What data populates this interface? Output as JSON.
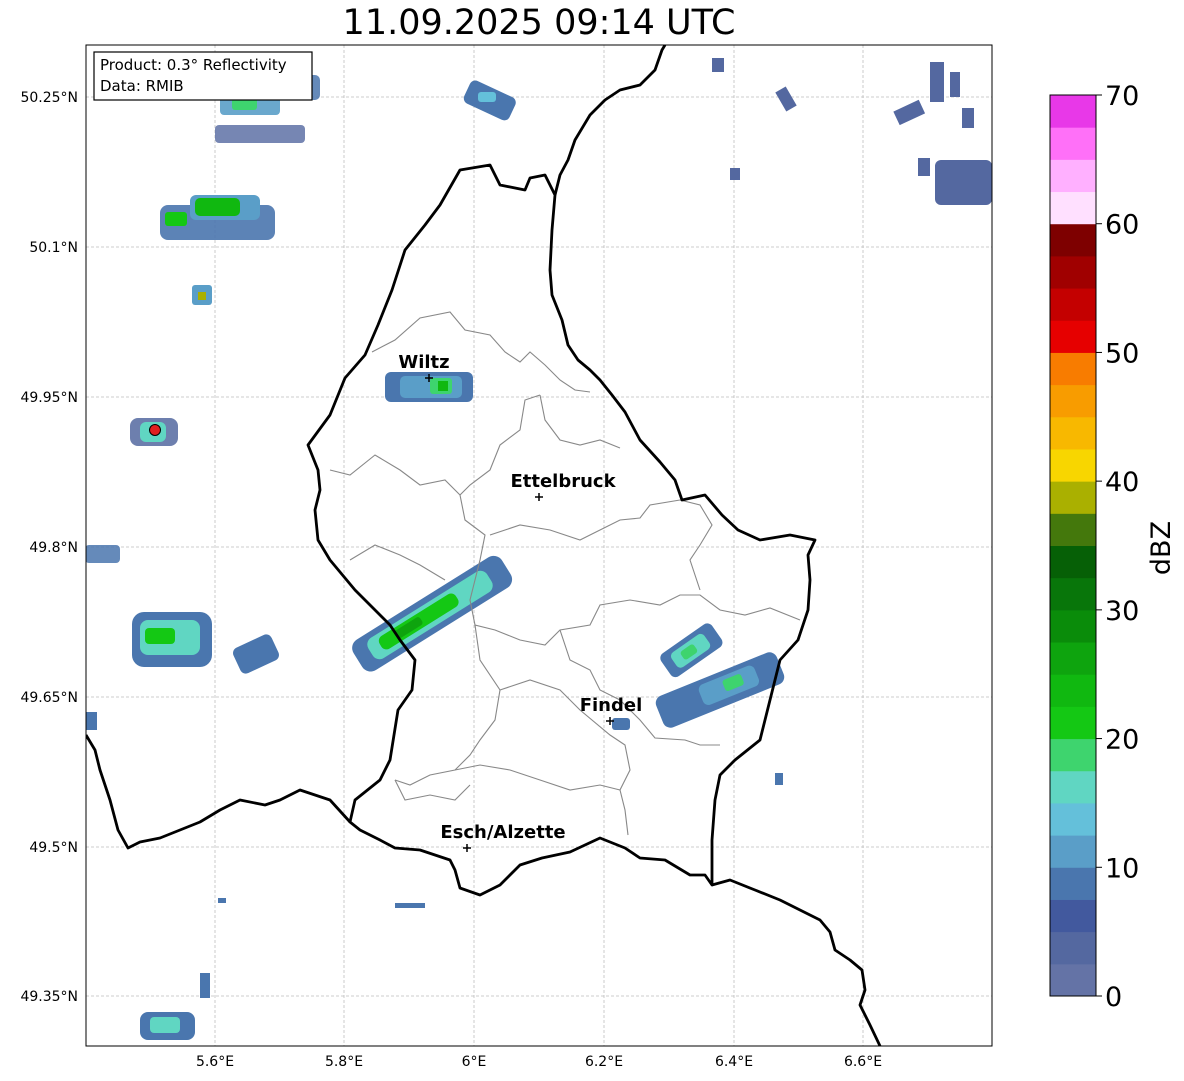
{
  "title": "11.09.2025 09:14 UTC",
  "info": {
    "product": "Product: 0.3° Reflectivity",
    "data": "Data: RMIB"
  },
  "latitude_labels": [
    "50.25°N",
    "50.1°N",
    "49.95°N",
    "49.8°N",
    "49.65°N",
    "49.5°N",
    "49.35°N"
  ],
  "longitude_labels": [
    "5.6°E",
    "5.8°E",
    "6°E",
    "6.2°E",
    "6.4°E",
    "6.6°E"
  ],
  "cities": [
    {
      "name": "Wiltz"
    },
    {
      "name": "Ettelbruck"
    },
    {
      "name": "Findel"
    },
    {
      "name": "Esch/Alzette"
    }
  ],
  "colorbar": {
    "label": "dBZ",
    "ticks": [
      "0",
      "10",
      "20",
      "30",
      "40",
      "50",
      "60",
      "70"
    ],
    "colors": [
      "#6473a6",
      "#5468a0",
      "#42599e",
      "#4a76ae",
      "#5a9ec8",
      "#64c0da",
      "#60d6c2",
      "#3ed46e",
      "#14c814",
      "#10b810",
      "#0ea40e",
      "#0a8c0a",
      "#08760a",
      "#066006",
      "#44780c",
      "#aab000",
      "#f8d600",
      "#f8b800",
      "#f89c00",
      "#f87c00",
      "#e60000",
      "#c40000",
      "#a00000",
      "#7e0000",
      "#ffe0ff",
      "#ffb0ff",
      "#ff70f8",
      "#e838e8"
    ]
  },
  "radar_site_color": "#e02020"
}
